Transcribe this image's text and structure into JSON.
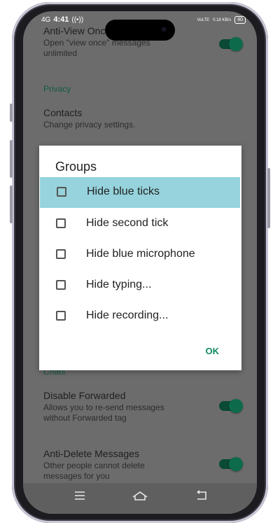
{
  "status_bar": {
    "network": "4G",
    "time": "4:41",
    "speed_top": "VoLTE",
    "speed_value": "0.18",
    "speed_unit": "KB/s",
    "battery": "80"
  },
  "settings": {
    "anti_view_once": {
      "title": "Anti-View Once",
      "subtitle_line1": "Open \"view once\" messages",
      "subtitle_line2": "unlimited",
      "enabled": true
    },
    "privacy_section": "Privacy",
    "contacts": {
      "title": "Contacts",
      "subtitle": "Change privacy settings."
    },
    "chats_section": "Chats",
    "disable_forwarded": {
      "title": "Disable Forwarded",
      "subtitle_line1": "Allows you to re-send messages",
      "subtitle_line2": "without Forwarded tag",
      "enabled": true
    },
    "anti_delete": {
      "title": "Anti-Delete Messages",
      "subtitle_line1": "Other people cannot delete",
      "subtitle_line2": "messages for you",
      "enabled": true
    }
  },
  "dialog": {
    "title": "Groups",
    "options": [
      {
        "label": "Hide blue ticks",
        "checked": false,
        "highlighted": true
      },
      {
        "label": "Hide second tick",
        "checked": false,
        "highlighted": false
      },
      {
        "label": "Hide blue microphone",
        "checked": false,
        "highlighted": false
      },
      {
        "label": "Hide typing...",
        "checked": false,
        "highlighted": false
      },
      {
        "label": "Hide recording...",
        "checked": false,
        "highlighted": false
      }
    ],
    "ok_label": "OK"
  },
  "navbar": {
    "menu_icon": "menu-icon",
    "home_icon": "home-icon",
    "back_icon": "back-icon"
  },
  "colors": {
    "accent": "#0f8a5f",
    "highlight": "#96d3dc",
    "scrim": "#6c6c6c"
  }
}
